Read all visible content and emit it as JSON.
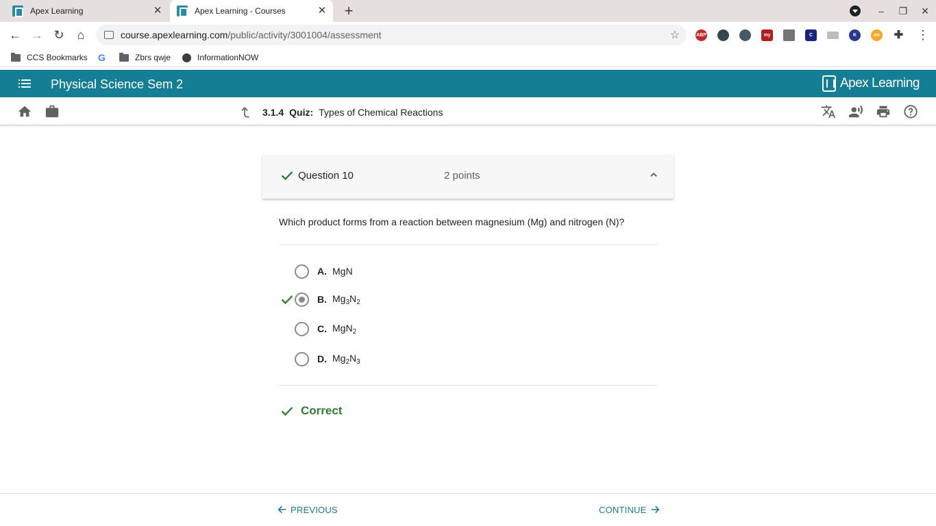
{
  "browser": {
    "tabs": [
      {
        "title": "Apex Learning"
      },
      {
        "title": "Apex Learning - Courses"
      }
    ],
    "url_host": "course.apexlearning.com",
    "url_path": "/public/activity/3001004/assessment",
    "bookmarks": [
      {
        "label": "CCS Bookmarks"
      },
      {
        "label": "Zbrs qwje"
      },
      {
        "label": "InformationNOW"
      }
    ],
    "extensions": [
      "ABP",
      "",
      "",
      "my",
      "",
      "C",
      "",
      "K",
      "on"
    ]
  },
  "header": {
    "course_title": "Physical Science Sem 2",
    "logo_text": "Apex Learning"
  },
  "subnav": {
    "number": "3.1.4",
    "kind": "Quiz:",
    "title": "Types of Chemical Reactions"
  },
  "question": {
    "title": "Question 10",
    "points": "2 points",
    "text": "Which product forms from a reaction between magnesium (Mg) and nitrogen (N)?",
    "options": [
      {
        "letter": "A.",
        "parts": [
          "MgN"
        ]
      },
      {
        "letter": "B.",
        "parts": [
          "Mg",
          "3",
          "N",
          "2"
        ]
      },
      {
        "letter": "C.",
        "parts": [
          "MgN",
          "2"
        ]
      },
      {
        "letter": "D.",
        "parts": [
          "Mg",
          "2",
          "N",
          "3"
        ]
      }
    ],
    "selected": "B.",
    "result": "Correct"
  },
  "footer": {
    "previous": "PREVIOUS",
    "continue": "CONTINUE"
  },
  "colors": {
    "brand": "#147e94",
    "correct": "#2e7d32",
    "link": "#1a7a8f"
  }
}
